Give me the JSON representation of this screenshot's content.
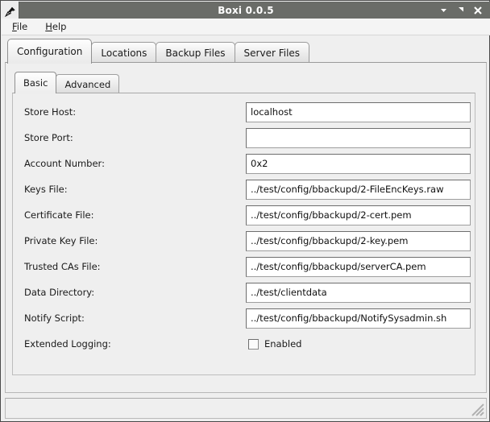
{
  "window": {
    "title": "Boxi 0.0.5",
    "pin_icon": "pushpin-icon",
    "buttons": [
      {
        "name": "minimize-button",
        "icon": "triangle-down-icon"
      },
      {
        "name": "maximize-button",
        "icon": "diagonal-arrow-icon"
      },
      {
        "name": "close-button",
        "icon": "close-x-icon"
      }
    ]
  },
  "menubar": {
    "items": [
      {
        "mnemonic": "F",
        "rest": "ile"
      },
      {
        "mnemonic": "H",
        "rest": "elp"
      }
    ]
  },
  "tabs": {
    "items": [
      {
        "label": "Configuration",
        "active": true
      },
      {
        "label": "Locations",
        "active": false
      },
      {
        "label": "Backup Files",
        "active": false
      },
      {
        "label": "Server Files",
        "active": false
      }
    ]
  },
  "subtabs": {
    "items": [
      {
        "label": "Basic",
        "active": true
      },
      {
        "label": "Advanced",
        "active": false
      }
    ]
  },
  "form": {
    "rows": [
      {
        "label": "Store Host:",
        "value": "localhost"
      },
      {
        "label": "Store Port:",
        "value": ""
      },
      {
        "label": "Account Number:",
        "value": "0x2"
      },
      {
        "label": "Keys File:",
        "value": "../test/config/bbackupd/2-FileEncKeys.raw"
      },
      {
        "label": "Certificate File:",
        "value": "../test/config/bbackupd/2-cert.pem"
      },
      {
        "label": "Private Key File:",
        "value": "../test/config/bbackupd/2-key.pem"
      },
      {
        "label": "Trusted CAs File:",
        "value": "../test/config/bbackupd/serverCA.pem"
      },
      {
        "label": "Data Directory:",
        "value": "../test/clientdata"
      },
      {
        "label": "Notify Script:",
        "value": "../test/config/bbackupd/NotifySysadmin.sh"
      }
    ],
    "checkbox_row": {
      "label": "Extended Logging:",
      "checkbox_label": "Enabled",
      "checked": false
    }
  },
  "statusbar": {
    "text": "",
    "grip_icon": "resize-grip-icon"
  },
  "colors": {
    "titlebar": "#6a6c68",
    "window_bg": "#efefef",
    "field_bg": "#ffffff",
    "border": "#4a4a4a"
  }
}
